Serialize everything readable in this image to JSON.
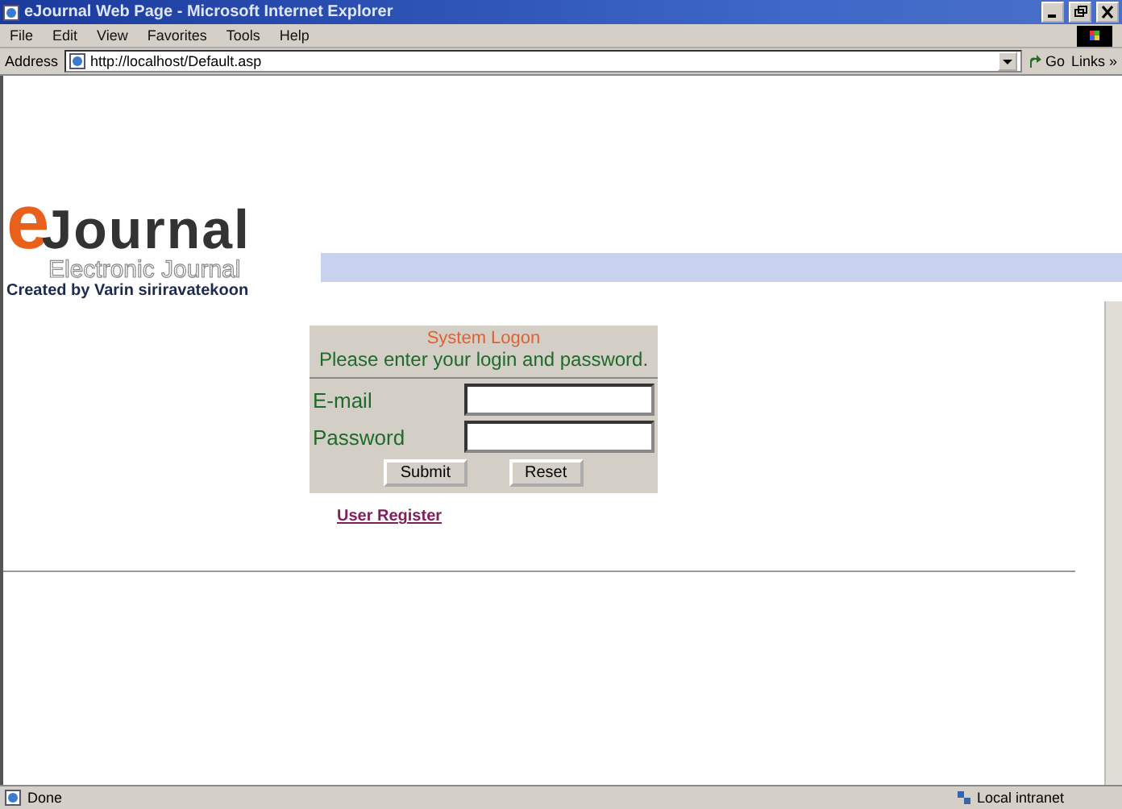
{
  "window": {
    "title": "eJournal Web Page - Microsoft Internet Explorer"
  },
  "menu": [
    "File",
    "Edit",
    "View",
    "Favorites",
    "Tools",
    "Help"
  ],
  "address_bar": {
    "label": "Address",
    "url": "http://localhost/Default.asp",
    "go": "Go",
    "links": "Links »"
  },
  "logo": {
    "mark": "e",
    "word": "Journal",
    "tagline": "Electronic Journal",
    "credit": "Created by Varin siriravatekoon"
  },
  "login": {
    "title": "System Logon",
    "prompt": "Please enter your login and password.",
    "fields": [
      {
        "label": "E-mail"
      },
      {
        "label": "Password"
      }
    ],
    "buttons": [
      "Submit",
      "Reset"
    ]
  },
  "register_link": "User Register",
  "status_bar": {
    "status": "Done",
    "zone": "Local intranet"
  }
}
